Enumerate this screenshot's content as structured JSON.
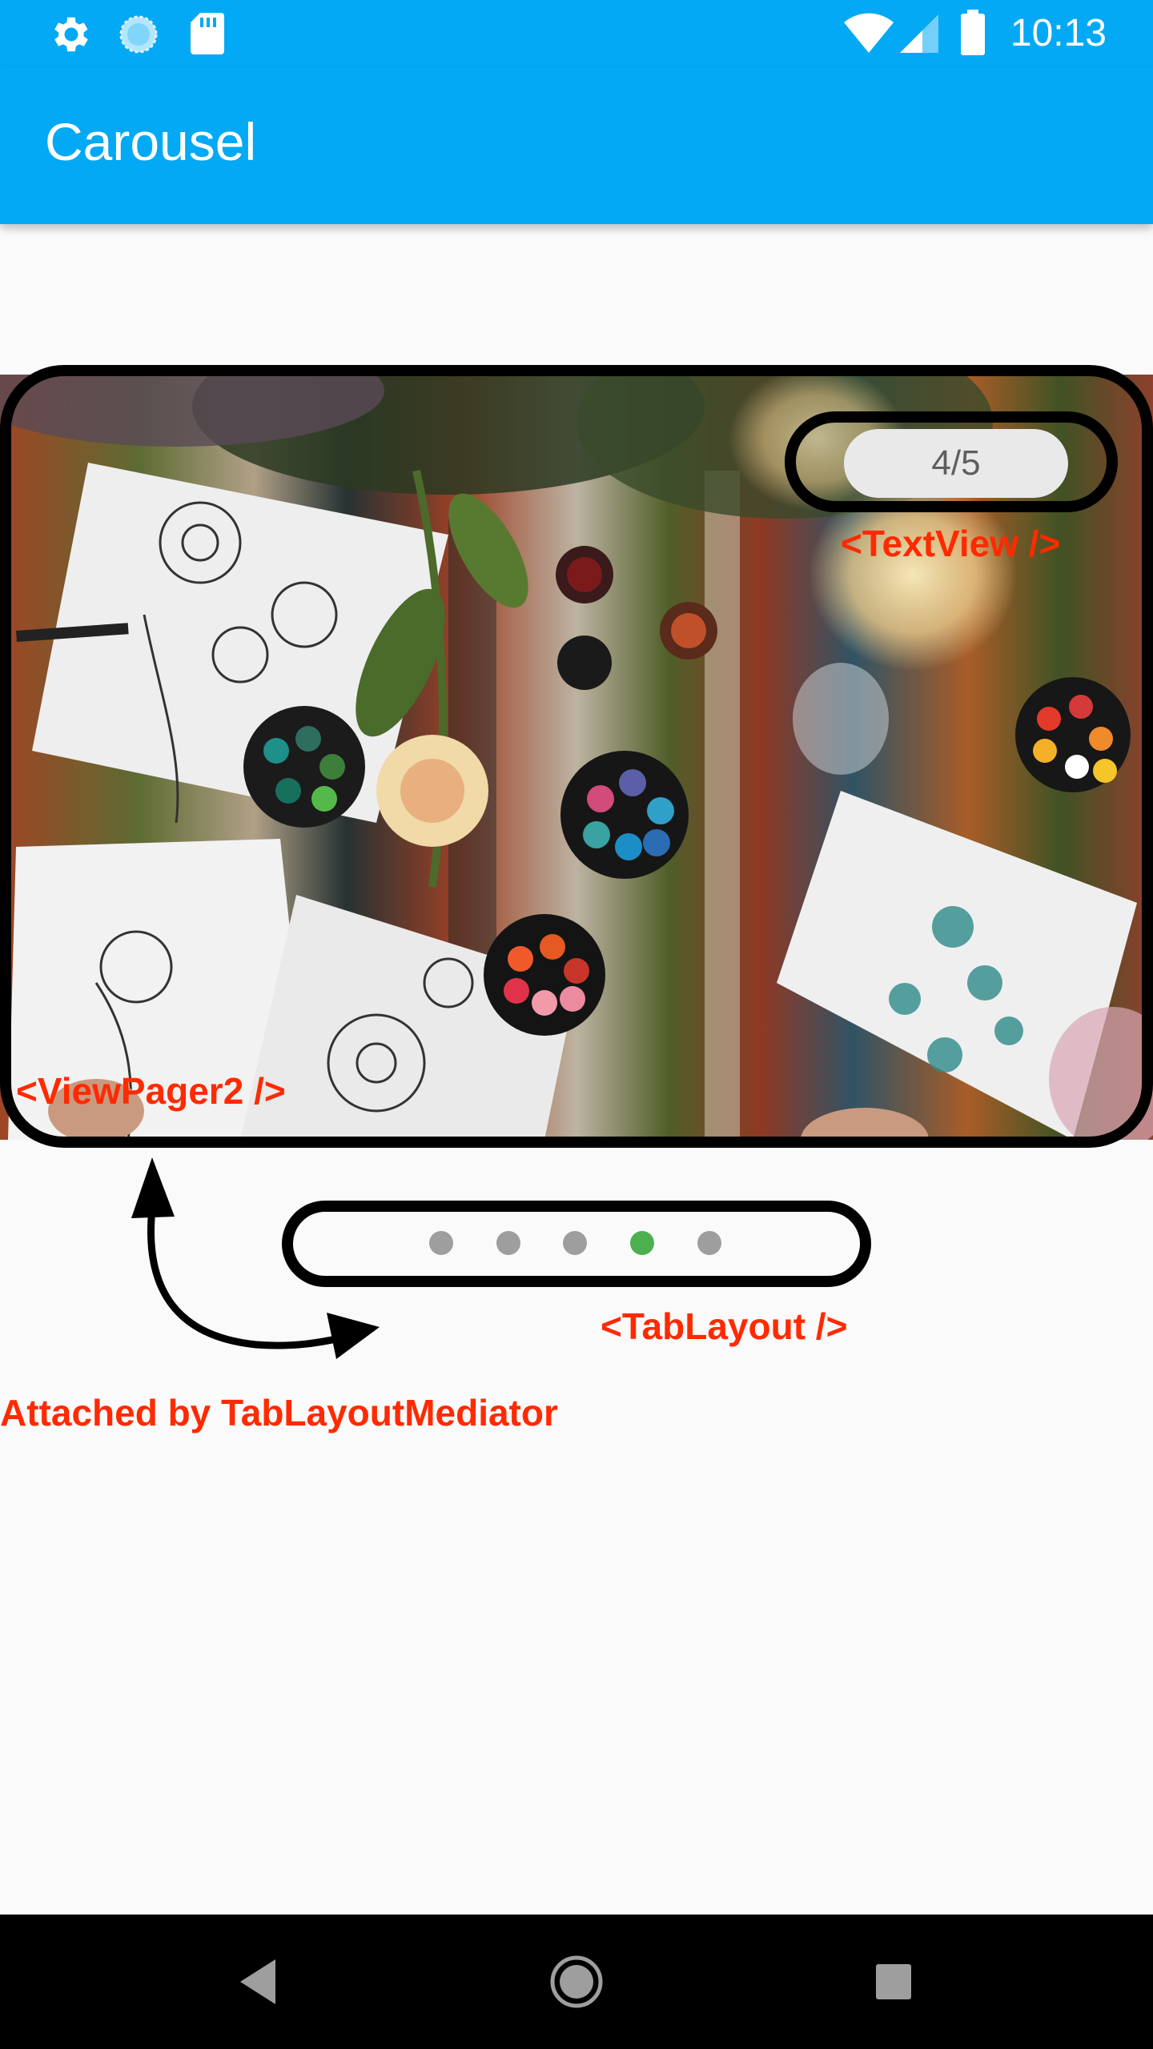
{
  "status_bar": {
    "time": "10:13",
    "left_icons": [
      "gear-icon",
      "sync-icon",
      "sd-card-icon"
    ],
    "right_icons": [
      "wifi-icon",
      "cell-signal-icon",
      "battery-icon"
    ],
    "color": "#03a9f4"
  },
  "app_bar": {
    "title": "Carousel",
    "color": "#03a9f4"
  },
  "carousel": {
    "image": "art-supplies-flower-drawings-photo",
    "counter": "4/5",
    "current_page": 4,
    "total_pages": 5
  },
  "tabs": {
    "active_index": 3,
    "active_color": "#4caf50",
    "inactive_color": "#9e9e9e"
  },
  "annotations": {
    "textview": "<TextView />",
    "viewpager": "<ViewPager2 />",
    "tablayout": "<TabLayout />",
    "mediator": "Attached by TabLayoutMediator",
    "label_color": "#ff2a00"
  },
  "nav_bar": {
    "buttons": [
      "back-icon",
      "home-icon",
      "recents-icon"
    ]
  }
}
